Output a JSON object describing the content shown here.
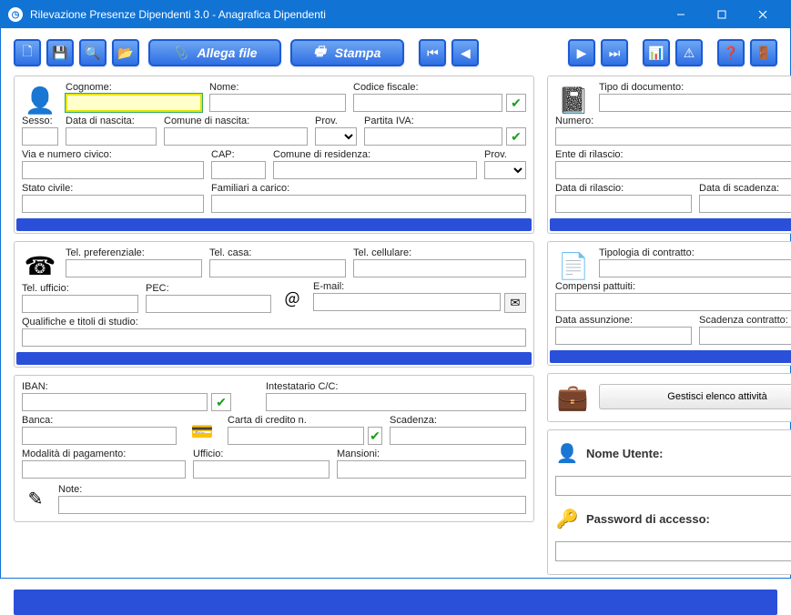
{
  "window": {
    "title": "Rilevazione Presenze Dipendenti 3.0 - Anagrafica Dipendenti"
  },
  "toolbar": {
    "attach": "Allega file",
    "print": "Stampa"
  },
  "personal": {
    "cognome_lbl": "Cognome:",
    "nome_lbl": "Nome:",
    "cf_lbl": "Codice fiscale:",
    "sesso_lbl": "Sesso:",
    "dn_lbl": "Data di nascita:",
    "cn_lbl": "Comune di nascita:",
    "prov_lbl": "Prov.",
    "piva_lbl": "Partita IVA:",
    "via_lbl": "Via e numero civico:",
    "cap_lbl": "CAP:",
    "cr_lbl": "Comune di residenza:",
    "prov2_lbl": "Prov.",
    "sc_lbl": "Stato civile:",
    "fc_lbl": "Familiari a carico:"
  },
  "contact": {
    "telpref_lbl": "Tel. preferenziale:",
    "telcasa_lbl": "Tel. casa:",
    "telcell_lbl": "Tel. cellulare:",
    "teluff_lbl": "Tel. ufficio:",
    "pec_lbl": "PEC:",
    "email_lbl": "E-mail:",
    "qual_lbl": "Qualifiche e titoli di studio:"
  },
  "bank": {
    "iban_lbl": "IBAN:",
    "int_lbl": "Intestatario C/C:",
    "banca_lbl": "Banca:",
    "cc_lbl": "Carta di credito n.",
    "scad_lbl": "Scadenza:",
    "mod_lbl": "Modalità di pagamento:",
    "uff_lbl": "Ufficio:",
    "mans_lbl": "Mansioni:",
    "note_lbl": "Note:"
  },
  "doc": {
    "tipo_lbl": "Tipo di documento:",
    "num_lbl": "Numero:",
    "ente_lbl": "Ente di rilascio:",
    "dr_lbl": "Data di rilascio:",
    "ds_lbl": "Data di scadenza:"
  },
  "contract": {
    "tipo_lbl": "Tipologia di contratto:",
    "comp_lbl": "Compensi pattuiti:",
    "da_lbl": "Data assunzione:",
    "sc_lbl": "Scadenza contratto:"
  },
  "activity": {
    "btn": "Gestisci elenco attività"
  },
  "login": {
    "user_lbl": "Nome Utente:",
    "pass_lbl": "Password di accesso:"
  }
}
